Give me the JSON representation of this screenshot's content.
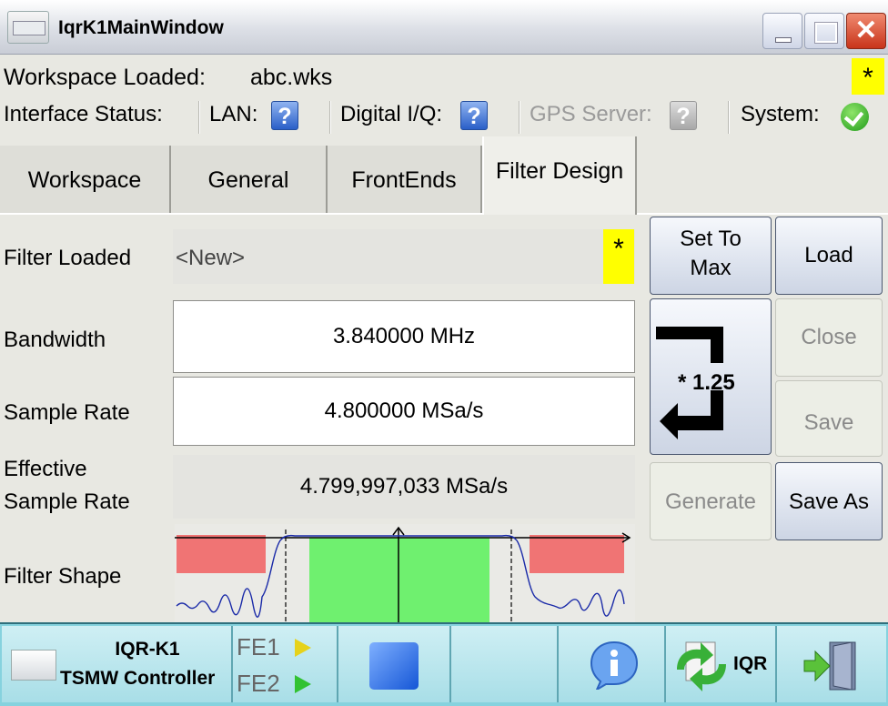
{
  "window": {
    "title": "IqrK1MainWindow"
  },
  "workspace": {
    "label": "Workspace Loaded:",
    "value": "abc.wks",
    "modified_mark": "*"
  },
  "interface_status": {
    "label": "Interface Status:",
    "lan": {
      "label": "LAN:",
      "status_icon": "question-icon"
    },
    "digital_iq": {
      "label": "Digital I/Q:",
      "status_icon": "question-icon"
    },
    "gps_server": {
      "label": "GPS Server:",
      "status_icon": "question-icon-disabled"
    },
    "system": {
      "label": "System:",
      "status_icon": "check-icon"
    },
    "icon_glyph": "?"
  },
  "tabs": [
    {
      "label": "Workspace"
    },
    {
      "label": "General"
    },
    {
      "label": "FrontEnds"
    },
    {
      "label": "Filter Design",
      "active": true
    }
  ],
  "filter_design": {
    "filter_loaded": {
      "label": "Filter Loaded",
      "value": "<New>",
      "modified_mark": "*"
    },
    "bandwidth": {
      "label": "Bandwidth",
      "value": "3.840000 MHz"
    },
    "sample_rate": {
      "label": "Sample Rate",
      "value": "4.800000 MSa/s"
    },
    "effective_sample_rate": {
      "label_line1": "Effective",
      "label_line2": "Sample Rate",
      "value": "4.799,997,033 MSa/s"
    },
    "filter_shape": {
      "label": "Filter Shape",
      "passband_color": "#6ff06f",
      "stopband_color": "#f07474",
      "response_color": "#1a2aa8"
    }
  },
  "buttons": {
    "set_to_max_line1": "Set To",
    "set_to_max_line2": "Max",
    "load": "Load",
    "close": "Close",
    "save": "Save",
    "ratio": "* 1.25",
    "generate": "Generate",
    "save_as": "Save As"
  },
  "bottom_bar": {
    "device_line1": "IQR-K1",
    "device_line2": "TSMW Controller",
    "fe1": "FE1",
    "fe2": "FE2",
    "fe1_indicator_color": "#e6d21a",
    "fe2_indicator_color": "#32c232",
    "iqr_label": "IQR"
  }
}
